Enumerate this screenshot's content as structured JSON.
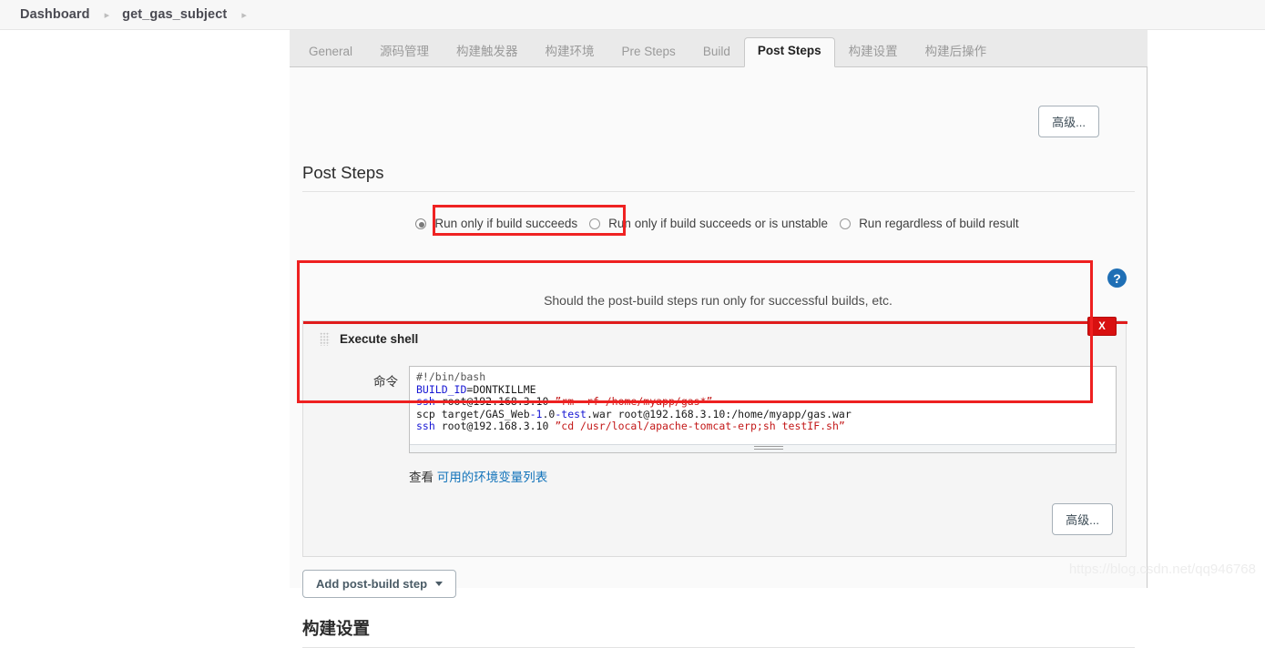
{
  "breadcrumb": {
    "items": [
      {
        "label": "Dashboard"
      },
      {
        "label": "get_gas_subject"
      }
    ],
    "separator": "▸"
  },
  "tabs": [
    {
      "label": "General",
      "active": false
    },
    {
      "label": "源码管理",
      "active": false
    },
    {
      "label": "构建触发器",
      "active": false
    },
    {
      "label": "构建环境",
      "active": false
    },
    {
      "label": "Pre Steps",
      "active": false
    },
    {
      "label": "Build",
      "active": false
    },
    {
      "label": "Post Steps",
      "active": true
    },
    {
      "label": "构建设置",
      "active": false
    },
    {
      "label": "构建后操作",
      "active": false
    }
  ],
  "toolbar": {
    "advanced_top_label": "高级...",
    "advanced_bottom_label": "高级..."
  },
  "section": {
    "post_steps_heading": "Post Steps",
    "help_text": "Should the post-build steps run only for successful builds, etc.",
    "build_settings_heading": "构建设置"
  },
  "run_condition": {
    "options": [
      {
        "label": "Run only if build succeeds",
        "selected": true
      },
      {
        "label": "Run only if build succeeds or is unstable",
        "selected": false
      },
      {
        "label": "Run regardless of build result",
        "selected": false
      }
    ]
  },
  "builder": {
    "title": "Execute shell",
    "grip_icon": "drag-handle-icon",
    "delete_label": "X",
    "help_label": "?",
    "command_label": "命令",
    "command_lines": [
      [
        {
          "t": "#!/bin/bash",
          "c": "cmt"
        }
      ],
      [
        {
          "t": "BUILD_ID",
          "c": "kw"
        },
        {
          "t": "=DONTKILLME",
          "c": ""
        }
      ],
      [
        {
          "t": "ssh",
          "c": "kw"
        },
        {
          "t": " root@192.168.3.10 ",
          "c": ""
        },
        {
          "t": "”rm -rf /home/myapp/gas*”",
          "c": "str"
        }
      ],
      [
        {
          "t": "scp target/GAS_Web",
          "c": ""
        },
        {
          "t": "-1",
          "c": "kw"
        },
        {
          "t": ".0",
          "c": ""
        },
        {
          "t": "-test",
          "c": "kw"
        },
        {
          "t": ".war root@192.168.3.10:/home/myapp/gas.war",
          "c": ""
        }
      ],
      [
        {
          "t": "ssh",
          "c": "kw"
        },
        {
          "t": " root@192.168.3.10 ",
          "c": ""
        },
        {
          "t": "”cd /usr/local/apache-tomcat-erp;sh testIF.sh”",
          "c": "str"
        }
      ]
    ],
    "env_link_prefix": "查看 ",
    "env_link_label": "可用的环境变量列表"
  },
  "add_step": {
    "label": "Add post-build step",
    "caret_icon": "chevron-down-icon"
  },
  "watermark": "https://blog.csdn.net/qq946768",
  "colors": {
    "accent_red": "#ee2020",
    "delete_red": "#d81010",
    "link_blue": "#1273ba",
    "help_blue": "#1f6fb5",
    "code_keyword": "#1717d4",
    "code_string": "#c31818"
  }
}
